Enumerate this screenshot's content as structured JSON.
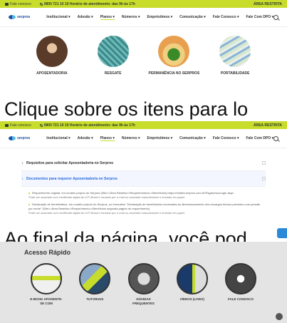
{
  "topbar": {
    "email_label": "Fale conosco",
    "phone_label": "0800 721 10 10 Horário de atendimento: das 9h às 17h",
    "restricted_label": "ÁREA RESTRITA"
  },
  "logo": {
    "text": "serpros"
  },
  "nav": {
    "items": [
      "Institucional ▾",
      "Adesão ▾",
      "Planos ▾",
      "Números ▾",
      "Empréstimos ▾",
      "Comunicação ▾",
      "Fale Conosco ▾",
      "Fale Com DPO ▾"
    ],
    "active_index": 2
  },
  "plans": [
    {
      "label": "APOSENTADORIA"
    },
    {
      "label": "RESGATE"
    },
    {
      "label": "PERMANÊNCIA NO SERPROS"
    },
    {
      "label": "PORTABILIDADE"
    }
  ],
  "overlay_text_1": "Clique sobre os itens para lo",
  "overlay_text_2": "Ao final da página, você pod",
  "accordion": {
    "row1": "Requisitos para solicitar Aposentadoria no Serpros",
    "row2": "Documentos para requerer Aposentadoria no Serpros",
    "body": [
      {
        "text": "Requerimento original, em modelo próprio do Serpros (Site>>Área Restrita>>Requerimentos>>Benefícios) https://restrita.serpros.com.br/PagAcessoLogin.aspx",
        "note": "Pode ser assinado com certificado digital do ICP-Brasil e enviado por e-mail ou assinado manualmente e enviado em papel."
      },
      {
        "text": "Declaração de beneficiários, em modelo próprio do Serpros, no formulário \"Declaração de beneficiários necessária ao dimensionamento dos encargos futuros previstos com pensão por morte\" (Site>>Área Restrita>>Requerimento>>Benefícios segunda página do requerimento)",
        "note": "Pode ser assinado com certificado digital do ICP-Brasil e enviado por e-mail ou assinado manualmente e enviado em papel."
      }
    ]
  },
  "quick_access": {
    "title": "Acesso Rápido",
    "items": [
      {
        "label": "E-BOOK APOSENTE-SE COM"
      },
      {
        "label": "TUTORIAIS"
      },
      {
        "label": "DÚVIDAS FREQUENTES"
      },
      {
        "label": "VÍDEOS (LIVES)"
      },
      {
        "label": "FALE CONOSCO"
      }
    ]
  },
  "colors": {
    "accent": "#c8dc2c",
    "brand": "#1d4fa3",
    "link": "#2a6ad8"
  }
}
